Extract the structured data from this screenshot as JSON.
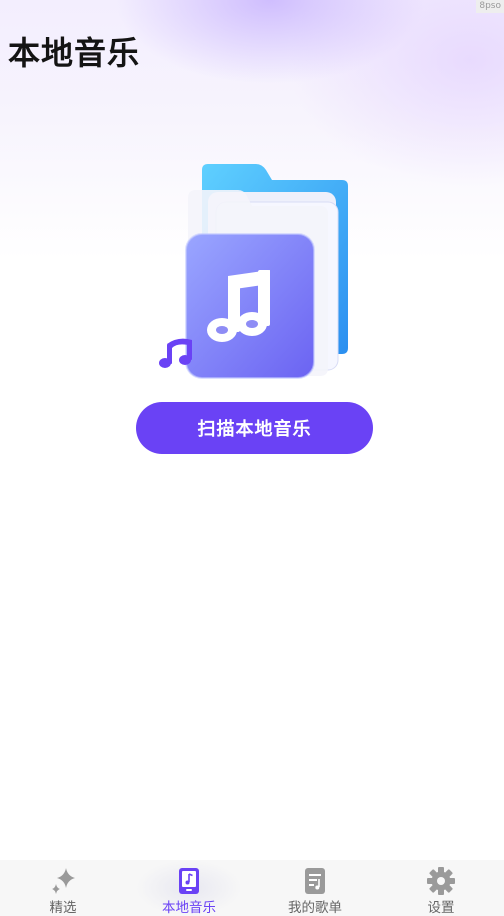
{
  "corner_tag": "8pso",
  "header": {
    "title": "本地音乐"
  },
  "main": {
    "scan_button_label": "扫描本地音乐"
  },
  "tabbar": {
    "active_color": "#6a42f5",
    "inactive_color": "#666666",
    "items": [
      {
        "label": "精选",
        "icon": "sparkle-icon",
        "active": false
      },
      {
        "label": "本地音乐",
        "icon": "phone-music-icon",
        "active": true
      },
      {
        "label": "我的歌单",
        "icon": "playlist-icon",
        "active": false
      },
      {
        "label": "设置",
        "icon": "gear-icon",
        "active": false
      }
    ]
  },
  "colors": {
    "accent": "#6a42f5",
    "title": "#141414"
  }
}
